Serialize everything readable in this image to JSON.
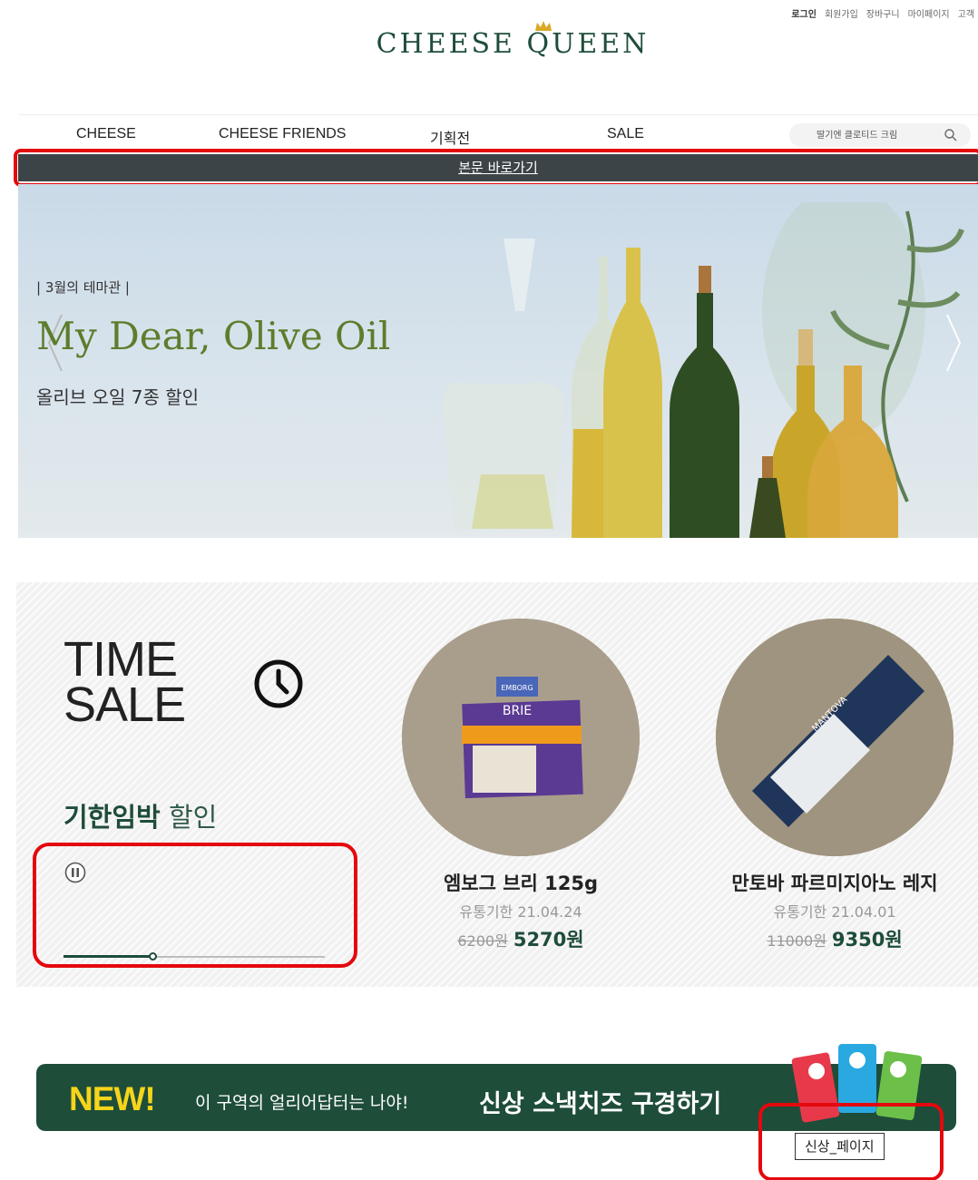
{
  "util_links": [
    "로그인",
    "회원가입",
    "장바구니",
    "마이페이지",
    "고객"
  ],
  "logo": {
    "text": "CHEESE QUEEN"
  },
  "nav": {
    "items": [
      "CHEESE",
      "CHEESE FRIENDS",
      "기획전",
      "SALE"
    ]
  },
  "search": {
    "placeholder": "딸기엔 클로티드 크림"
  },
  "skip_link": "본문 바로가기",
  "hero": {
    "kicker": "| 3월의 테마관 |",
    "title": "My Dear, Olive Oil",
    "subtitle": "올리브 오일 7종 할인"
  },
  "time_sale": {
    "title_line1": "TIME",
    "title_line2": "SALE",
    "label_bold": "기한임박",
    "label_rest": " 할인",
    "progress": 0.34,
    "products": [
      {
        "name": "엠보그 브리 125g",
        "expiry": "유통기한 21.04.24",
        "old_price": "6200원",
        "new_price": "5270원"
      },
      {
        "name": "만토바 파르미지아노 레지",
        "expiry": "유통기한 21.04.01",
        "old_price": "11000원",
        "new_price": "9350원"
      }
    ],
    "brie_box": {
      "brand": "EMBORG",
      "name": "BRIE"
    },
    "parm_brand": "MANTOVA"
  },
  "new_banner": {
    "new_label": "NEW!",
    "text": "이 구역의 얼리어답터는 나야!",
    "strong": "신상 스낵치즈 구경하기",
    "tooltip": "신상_페이지"
  },
  "colors": {
    "brand_green": "#1e4d3a",
    "skip_bar": "#3d4447",
    "highlight_red": "#e3090d",
    "new_yellow": "#f5d41a"
  },
  "icons": [
    "crown-icon",
    "search-icon",
    "chevron-left-icon",
    "chevron-right-icon",
    "clock-icon",
    "pause-icon"
  ]
}
